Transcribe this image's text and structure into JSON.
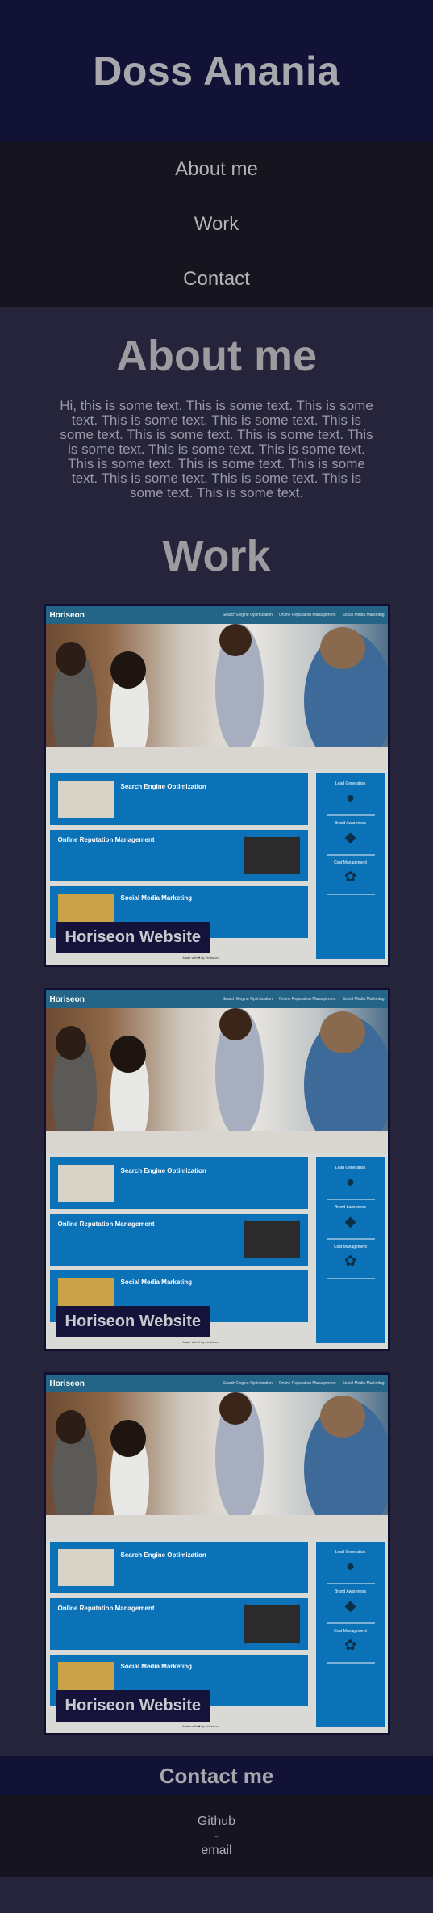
{
  "site": {
    "title": "Doss Anania"
  },
  "nav": {
    "items": [
      "About me",
      "Work",
      "Contact"
    ]
  },
  "about": {
    "heading": "About me",
    "text": "Hi, this is some text. This is some text. This is some text. This is some text. This is some text. This is some text. This is some text. This is some text. This is some text. This is some text. This is some text. This is some text. This is some text. This is some text. This is some text. This is some text. This is some text. This is some text."
  },
  "work": {
    "heading": "Work",
    "projects": [
      {
        "label": "Horiseon Website"
      },
      {
        "label": "Horiseon Website"
      },
      {
        "label": "Horiseon Website"
      }
    ],
    "screenshot": {
      "brand": "Horiseon",
      "nav": [
        "Search Engine Optimization",
        "Online Reputation Management",
        "Social Media Marketing"
      ],
      "items": [
        "Search Engine Optimization",
        "Online Reputation Management",
        "Social Media Marketing"
      ],
      "sidebar": [
        "Lead Generation",
        "Brand Awareness",
        "Cost Management"
      ],
      "footer": "Made with ♥ by Horiseon"
    }
  },
  "contact": {
    "heading": "Contact me",
    "items": [
      "Github",
      "-",
      "email"
    ]
  },
  "colors": {
    "header_bg": "#121136",
    "nav_bg": "#15141f",
    "page_bg": "#25243a",
    "shot_blue": "#0b72b7"
  }
}
